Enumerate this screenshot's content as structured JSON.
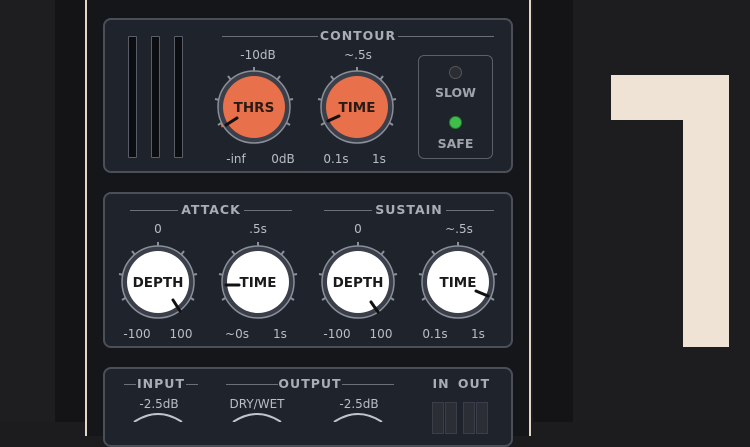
{
  "contour": {
    "title": "CONTOUR",
    "thrs": {
      "label": "THRS",
      "top": "-10dB",
      "min": "-inf",
      "max": "0dB"
    },
    "time": {
      "label": "TIME",
      "top": "~.5s",
      "min": "0.1s",
      "max": "1s"
    },
    "slow_label": "SLOW",
    "safe_label": "SAFE"
  },
  "attack": {
    "title": "ATTACK",
    "depth": {
      "label": "DEPTH",
      "top": "0",
      "min": "-100",
      "max": "100"
    },
    "time": {
      "label": "TIME",
      "top": ".5s",
      "min": "~0s",
      "max": "1s"
    }
  },
  "sustain": {
    "title": "SUSTAIN",
    "depth": {
      "label": "DEPTH",
      "top": "0",
      "min": "-100",
      "max": "100"
    },
    "time": {
      "label": "TIME",
      "top": "~.5s",
      "min": "0.1s",
      "max": "1s"
    }
  },
  "bottom": {
    "input_title": "INPUT",
    "output_title": "OUTPUT",
    "in_label": "IN",
    "out_label": "OUT",
    "input_value": "-2.5dB",
    "drywet_label": "DRY/WET",
    "output_value": "-2.5dB"
  },
  "big_number": "1",
  "colors": {
    "accent_orange": "#e8704a",
    "safe_led": "#3fbf4a",
    "cream": "#efe3d5"
  }
}
